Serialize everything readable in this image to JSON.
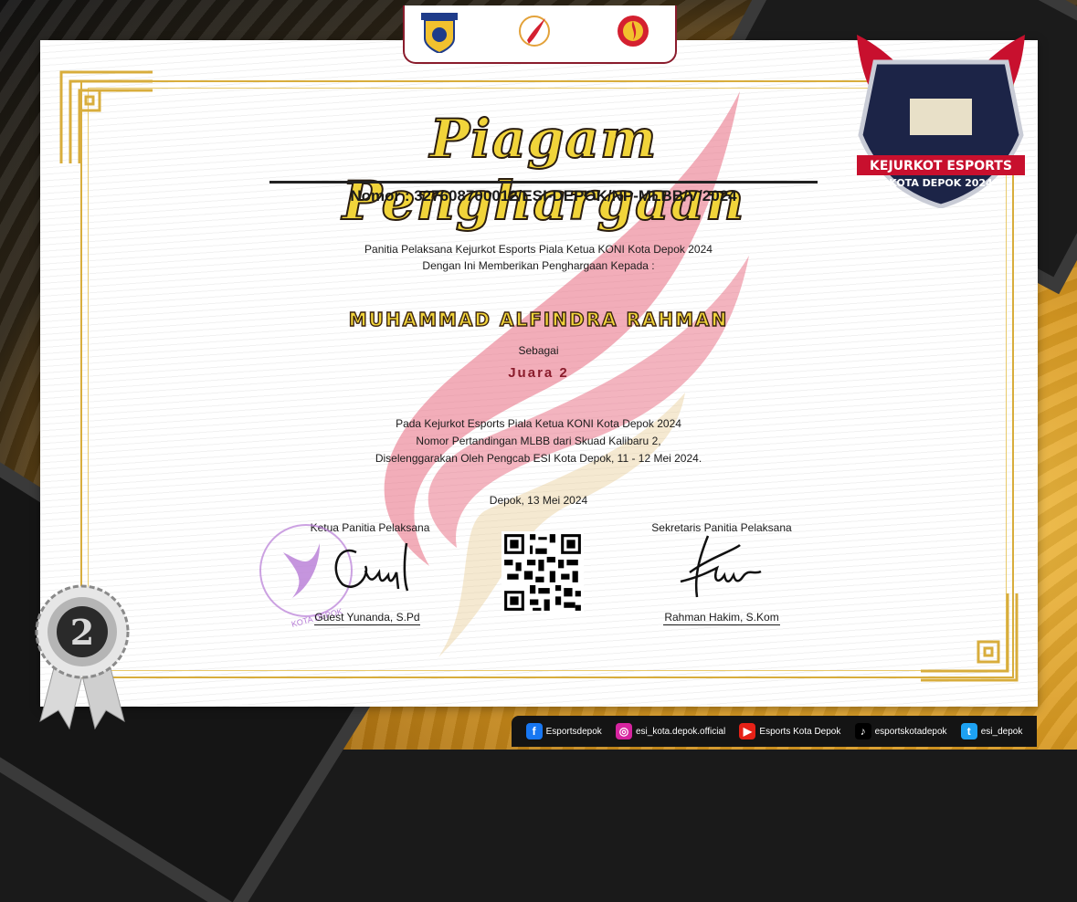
{
  "colors": {
    "gold": "#f1d43a",
    "maroon": "#8a1c2c",
    "ink": "#1b1b1b",
    "frame_gold": "#d8ad3c"
  },
  "logos": {
    "kota_depok": "KOTA DEPOK",
    "koni": "KONI KOTA DEPOK"
  },
  "certificate": {
    "title": "Piagam Penghargaan",
    "nomor": "Nomor : 327608700012/ESI-DEPOK/NP-MLBB/V/2024",
    "intro_line1": "Panitia Pelaksana Kejurkot Esports Piala Ketua KONI Kota Depok 2024",
    "intro_line2": "Dengan Ini Memberikan Penghargaan Kepada :",
    "recipient": "MUHAMMAD ALFINDRA RAHMAN",
    "sebagai": "Sebagai",
    "award": "Juara 2",
    "desc_line1": "Pada Kejurkot Esports Piala Ketua KONI Kota Depok 2024",
    "desc_line2": "Nomor Pertandingan MLBB dari Skuad Kalibaru 2,",
    "desc_line3": "Diselenggarakan Oleh Pengcab ESI Kota Depok, 11 - 12 Mei 2024.",
    "date": "Depok, 13 Mei 2024"
  },
  "signatures": {
    "left_role": "Ketua Panitia Pelaksana",
    "left_name": "Guest Yunanda, S.Pd",
    "right_role": "Sekretaris Panitia Pelaksana",
    "right_name": "Rahman Hakim, S.Kom",
    "stamp_text": "KOTA DEPOK"
  },
  "emblem": {
    "line1": "KEJURKOT ESPORTS",
    "line2": "KOTA DEPOK 2024"
  },
  "medal": {
    "rank": "2"
  },
  "footer": {
    "items": [
      {
        "icon": "facebook-icon",
        "label": "Esportsdepok",
        "color": "#1877f2",
        "glyph": "f"
      },
      {
        "icon": "instagram-icon",
        "label": "esi_kota.depok.official",
        "color": "#d6249f",
        "glyph": "◎"
      },
      {
        "icon": "youtube-icon",
        "label": "Esports Kota Depok",
        "color": "#e62117",
        "glyph": "▶"
      },
      {
        "icon": "tiktok-icon",
        "label": "esportskotadepok",
        "color": "#000000",
        "glyph": "♪"
      },
      {
        "icon": "twitter-icon",
        "label": "esi_depok",
        "color": "#1da1f2",
        "glyph": "t"
      }
    ]
  }
}
